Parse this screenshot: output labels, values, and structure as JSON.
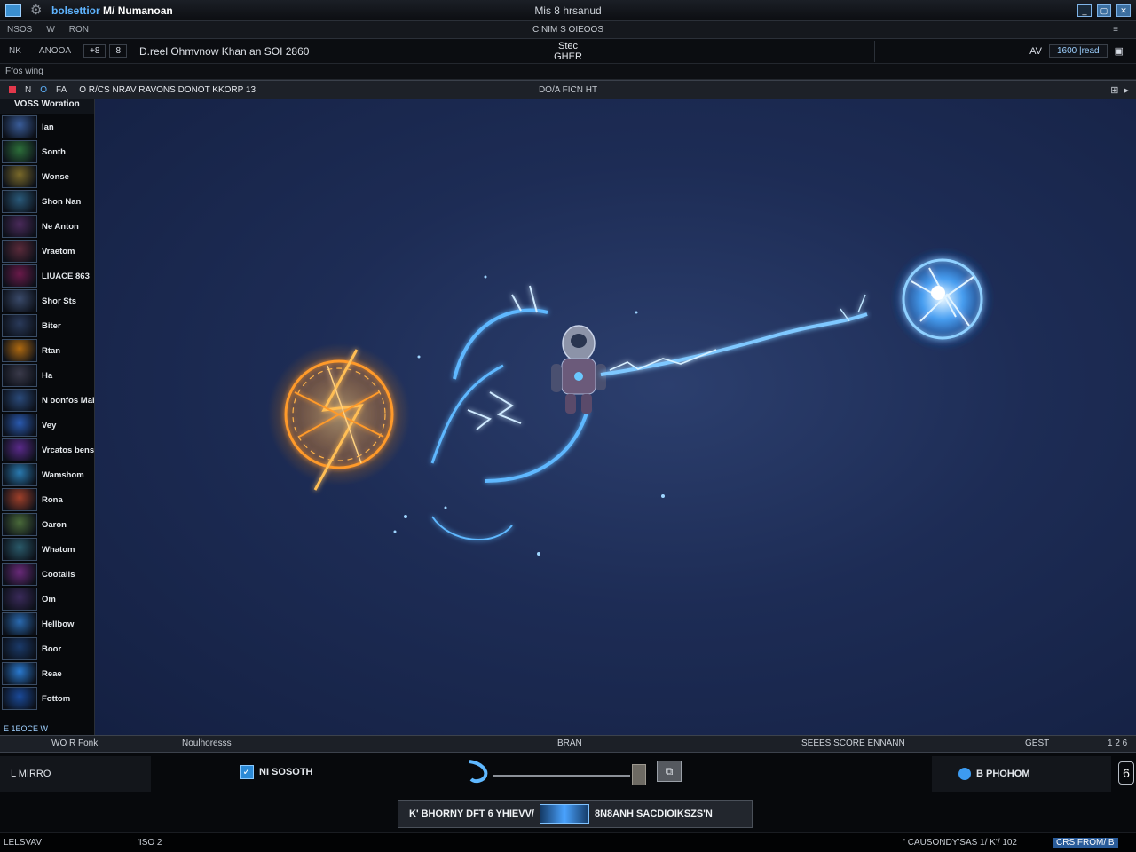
{
  "window": {
    "app_title_a": "bolsettior",
    "app_title_b": "M/",
    "app_title_c": "Numanoan",
    "center_title": "Mis 8 hrsanud"
  },
  "menubar": {
    "items": [
      "NSOS",
      "W",
      "RON"
    ],
    "center": "C NIM S OIEOOS",
    "right": "≡"
  },
  "toolbar": {
    "item1": "NK",
    "item2": "ANOOA",
    "box1": "+8",
    "box2": "8",
    "path": "D.reel Ohmvnow Khan an SOI 2860",
    "mid_label_1": "Stec",
    "mid_label_2": "GHER",
    "right_label": "AV",
    "right_input": "1600 |read",
    "right_icon": "▣"
  },
  "subbar": {
    "label": "Ffos wing"
  },
  "viewport_toolbar": {
    "icons": [
      "N",
      "O",
      "FA"
    ],
    "label": "O R/CS NRAV RAVONS DONOT KKORP 13",
    "center": "DO/A FICN HT",
    "right": [
      "⊞",
      "▸"
    ]
  },
  "sidebar": {
    "header": "VOSS Woration",
    "items": [
      {
        "label": "lan",
        "color": "#3a5d9a"
      },
      {
        "label": "Sonth",
        "color": "#2d6f3a"
      },
      {
        "label": "Wonse",
        "color": "#7a6a2a"
      },
      {
        "label": "Shon Nan",
        "color": "#2a5a7a"
      },
      {
        "label": "Ne Anton",
        "color": "#4a2a5a"
      },
      {
        "label": "Vraetom",
        "color": "#5a2a3a"
      },
      {
        "label": "LIUACE 863",
        "color": "#6a1a4a"
      },
      {
        "label": "Shor Sts",
        "color": "#3a4a6a"
      },
      {
        "label": "Biter",
        "color": "#2a3a5a"
      },
      {
        "label": "Rtan",
        "color": "#b06a10"
      },
      {
        "label": "Ha",
        "color": "#3a3a4a"
      },
      {
        "label": "N oonfos Mahed",
        "color": "#2a4a7a"
      },
      {
        "label": "Vey",
        "color": "#2a5ab0"
      },
      {
        "label": "Vrcatos benson",
        "color": "#5a2a8a"
      },
      {
        "label": "Wamshom",
        "color": "#2a7ab0"
      },
      {
        "label": "Rona",
        "color": "#a0402a"
      },
      {
        "label": "Oaron",
        "color": "#4a6a3a"
      },
      {
        "label": "Whatom",
        "color": "#2a5a6a"
      },
      {
        "label": "Cootalls",
        "color": "#6a2a7a"
      },
      {
        "label": "Om",
        "color": "#3a2a5a"
      },
      {
        "label": "Hellbow",
        "color": "#2a6ab0"
      },
      {
        "label": "Boor",
        "color": "#1a3a6a"
      },
      {
        "label": "Reae",
        "color": "#2a7ad0"
      },
      {
        "label": "Fottom",
        "color": "#1a4a9a"
      }
    ],
    "footer": "E 1EOCE W"
  },
  "viewport": {
    "orange_sigil_color": "#ff9a2a",
    "blue_orb_color": "#7fc8ff",
    "lightning_color": "#5fb8ff"
  },
  "timeline": {
    "left": "WO  R Fonk",
    "col2": "Noulhoresss",
    "col3": "BRAN",
    "col4": "SEEES SCORE ENNANN",
    "col5": "GEST",
    "col6": "1 2 6"
  },
  "playback": {
    "left_field": "L MIRRO",
    "checkbox_label": "NI SOSOTH",
    "snap": "⧉",
    "right_field": "B PHOHOM",
    "end_btn": "6"
  },
  "status": {
    "text_left": "K' BHORNY DFT 6 YHIEVV/",
    "text_right": "8N8ANH  SACDIOIKSZS'N"
  },
  "footer": {
    "left": "LELSVAV",
    "mid": "'ISO  2",
    "right_text": "' CAUSONDY'SAS 1/ K'/ 102",
    "tag": "CRS FROM/ B"
  }
}
